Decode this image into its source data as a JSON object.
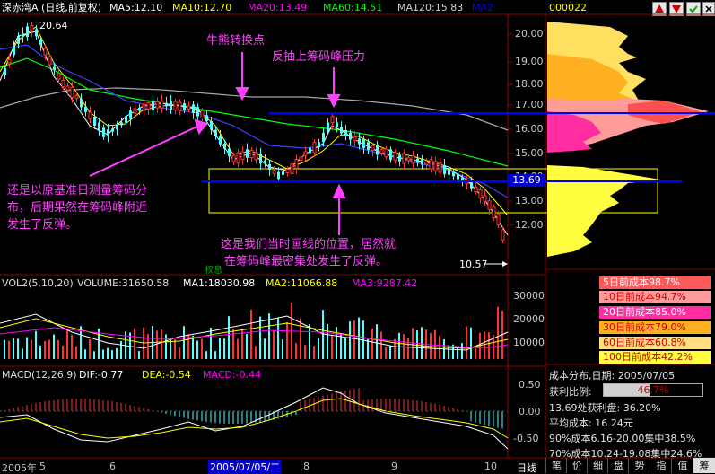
{
  "header": {
    "stock_title": "深赤湾A (日线,前复权)",
    "ma5": "MA5:12.10",
    "ma10": "MA10:12.70",
    "ma20": "MA20:13.49",
    "ma60": "MA60:14.51",
    "ma120": "MA120:15.83",
    "ma2": "MA2"
  },
  "side_header": {
    "code": "000022"
  },
  "main_chart": {
    "high_label": "20.64",
    "low_label": "10.57",
    "price_ticks": [
      "20.00",
      "19.00",
      "18.00",
      "17.00",
      "16.00",
      "15.00",
      "14.00",
      "13.00",
      "12.00"
    ],
    "level_badge": "13.69",
    "right_badge": "权息"
  },
  "annotations": {
    "turn_point": "牛熊转换点",
    "rebound_pressure": "反抽上筹码峰压力",
    "left_note_1": "还是以原基准日测量筹码分",
    "left_note_2": "布，后期果然在筹码峰附近",
    "left_note_3": "发生了反弹。",
    "bottom_note_1": "这是我们当时画线的位置，居然就",
    "bottom_note_2": "在筹码峰最密集处发生了反弹。"
  },
  "volume": {
    "title": "VOL2(5,10,20)",
    "volume": "VOLUME:31650.58",
    "ma1": "MA1:18030.98",
    "ma2": "MA2:11066.88",
    "ma3": "MA3:9287.42",
    "ticks": [
      "30000",
      "20000",
      "10000"
    ]
  },
  "macd": {
    "title": "MACD(12,26,9)",
    "dif": "DIF:-0.77",
    "dea": "DEA:-0.54",
    "macd": "MACD:-0.44",
    "ticks": [
      "0.50",
      "0.00",
      "-0.50"
    ]
  },
  "xaxis": {
    "year": "2005年",
    "m5": "5",
    "m6": "6",
    "cursor_date": "2005/07/05/二",
    "m8": "8",
    "m9": "9",
    "m10": "10",
    "period": "日线"
  },
  "chip_legend": [
    {
      "label": "5日前成本98.7%",
      "color": "#ff5a5a"
    },
    {
      "label": "10日前成本94.7%",
      "color": "#ff9b9b"
    },
    {
      "label": "20日前成本85.0%",
      "color": "#ff2da0"
    },
    {
      "label": "30日前成本79.0%",
      "color": "#ffb020"
    },
    {
      "label": "60日前成本60.8%",
      "color": "#ffe080"
    },
    {
      "label": "100日前成本42.2%",
      "color": "#ffff40"
    }
  ],
  "chip_info": {
    "title": "成本分布,日期: 2005/07/05",
    "profit_label": "获利比例:",
    "profit_value": "46.7%",
    "profit_at": "13.69处获利盘: 36.20%",
    "avg_cost": "平均成本: 16.24元",
    "c90": "90%成本6.16-20.00集中38.5%",
    "c70": "70%成本10.24-19.08集中24.6%"
  },
  "tabs": [
    "笔",
    "价",
    "细",
    "盘",
    "势",
    "指",
    "值",
    "筹"
  ],
  "colors": {
    "up": "#ff3232",
    "down": "#54ffff",
    "ma5": "#ffffff",
    "ma10": "#ffff00",
    "ma20": "#ff00ff",
    "ma60": "#00ff00",
    "ma120": "#bfbfbf",
    "annotation": "#ff40ff",
    "hline": "#0000ff"
  }
}
